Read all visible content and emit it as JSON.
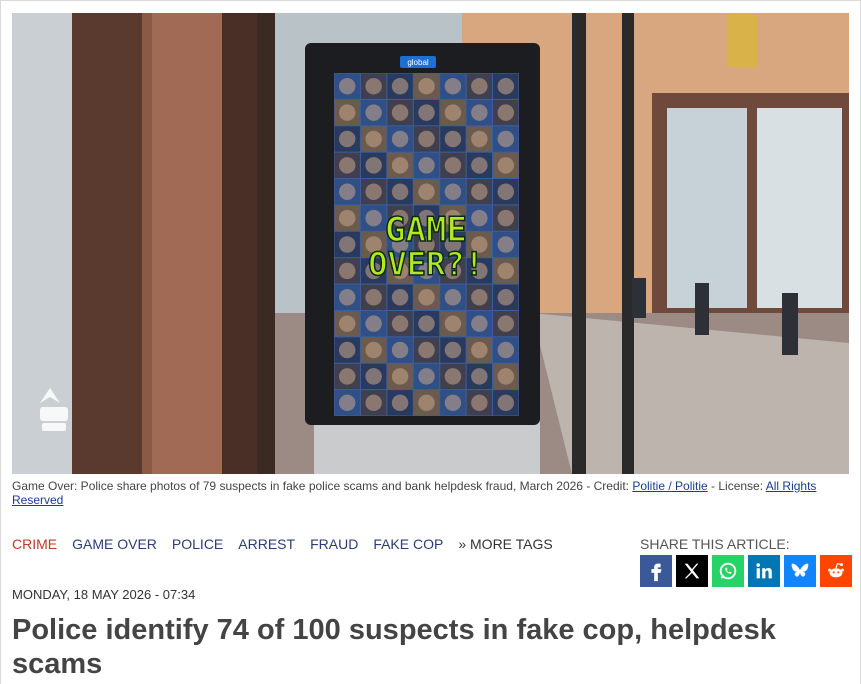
{
  "photo": {
    "alt": "Game Over digital display screen in doorway",
    "screen_brand": "global",
    "screen_text_line1": "GAME",
    "screen_text_line2": "OVER?!"
  },
  "caption": {
    "text": "Game Over: Police share photos of 79 suspects in fake police scams and bank helpdesk fraud, March 2026 - Credit: ",
    "credit_link": "Politie / Politie",
    "license_prefix": " - License: ",
    "license_link": "All Rights Reserved"
  },
  "tags": [
    "CRIME",
    "GAME OVER",
    "POLICE",
    "ARREST",
    "FRAUD",
    "FAKE COP"
  ],
  "more_tags": "» MORE TAGS",
  "share": {
    "label": "SHARE THIS ARTICLE:",
    "buttons": [
      {
        "name": "facebook",
        "color": "#3b5998"
      },
      {
        "name": "x",
        "color": "#000000"
      },
      {
        "name": "whatsapp",
        "color": "#25d366"
      },
      {
        "name": "linkedin",
        "color": "#0077b5"
      },
      {
        "name": "bluesky",
        "color": "#1185fe"
      },
      {
        "name": "reddit",
        "color": "#ff4500"
      }
    ]
  },
  "date": "MONDAY, 18 MAY 2026 - 07:34",
  "headline": "Police identify 74 of 100 suspects in fake cop, helpdesk scams"
}
